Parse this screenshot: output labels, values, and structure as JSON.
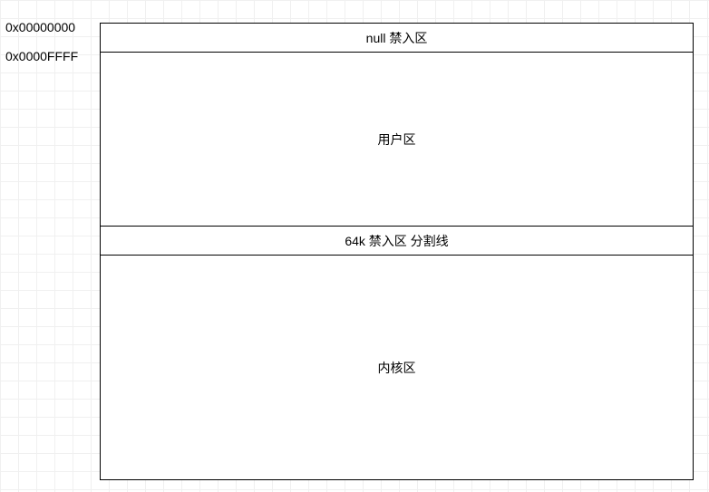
{
  "labels": {
    "addr_top": "0x00000000",
    "addr_ffff": "0x0000FFFF"
  },
  "regions": {
    "null_zone": "null 禁入区",
    "user_zone": "用户区",
    "separator": "64k 禁入区 分割线",
    "kernel_zone": "内核区"
  }
}
